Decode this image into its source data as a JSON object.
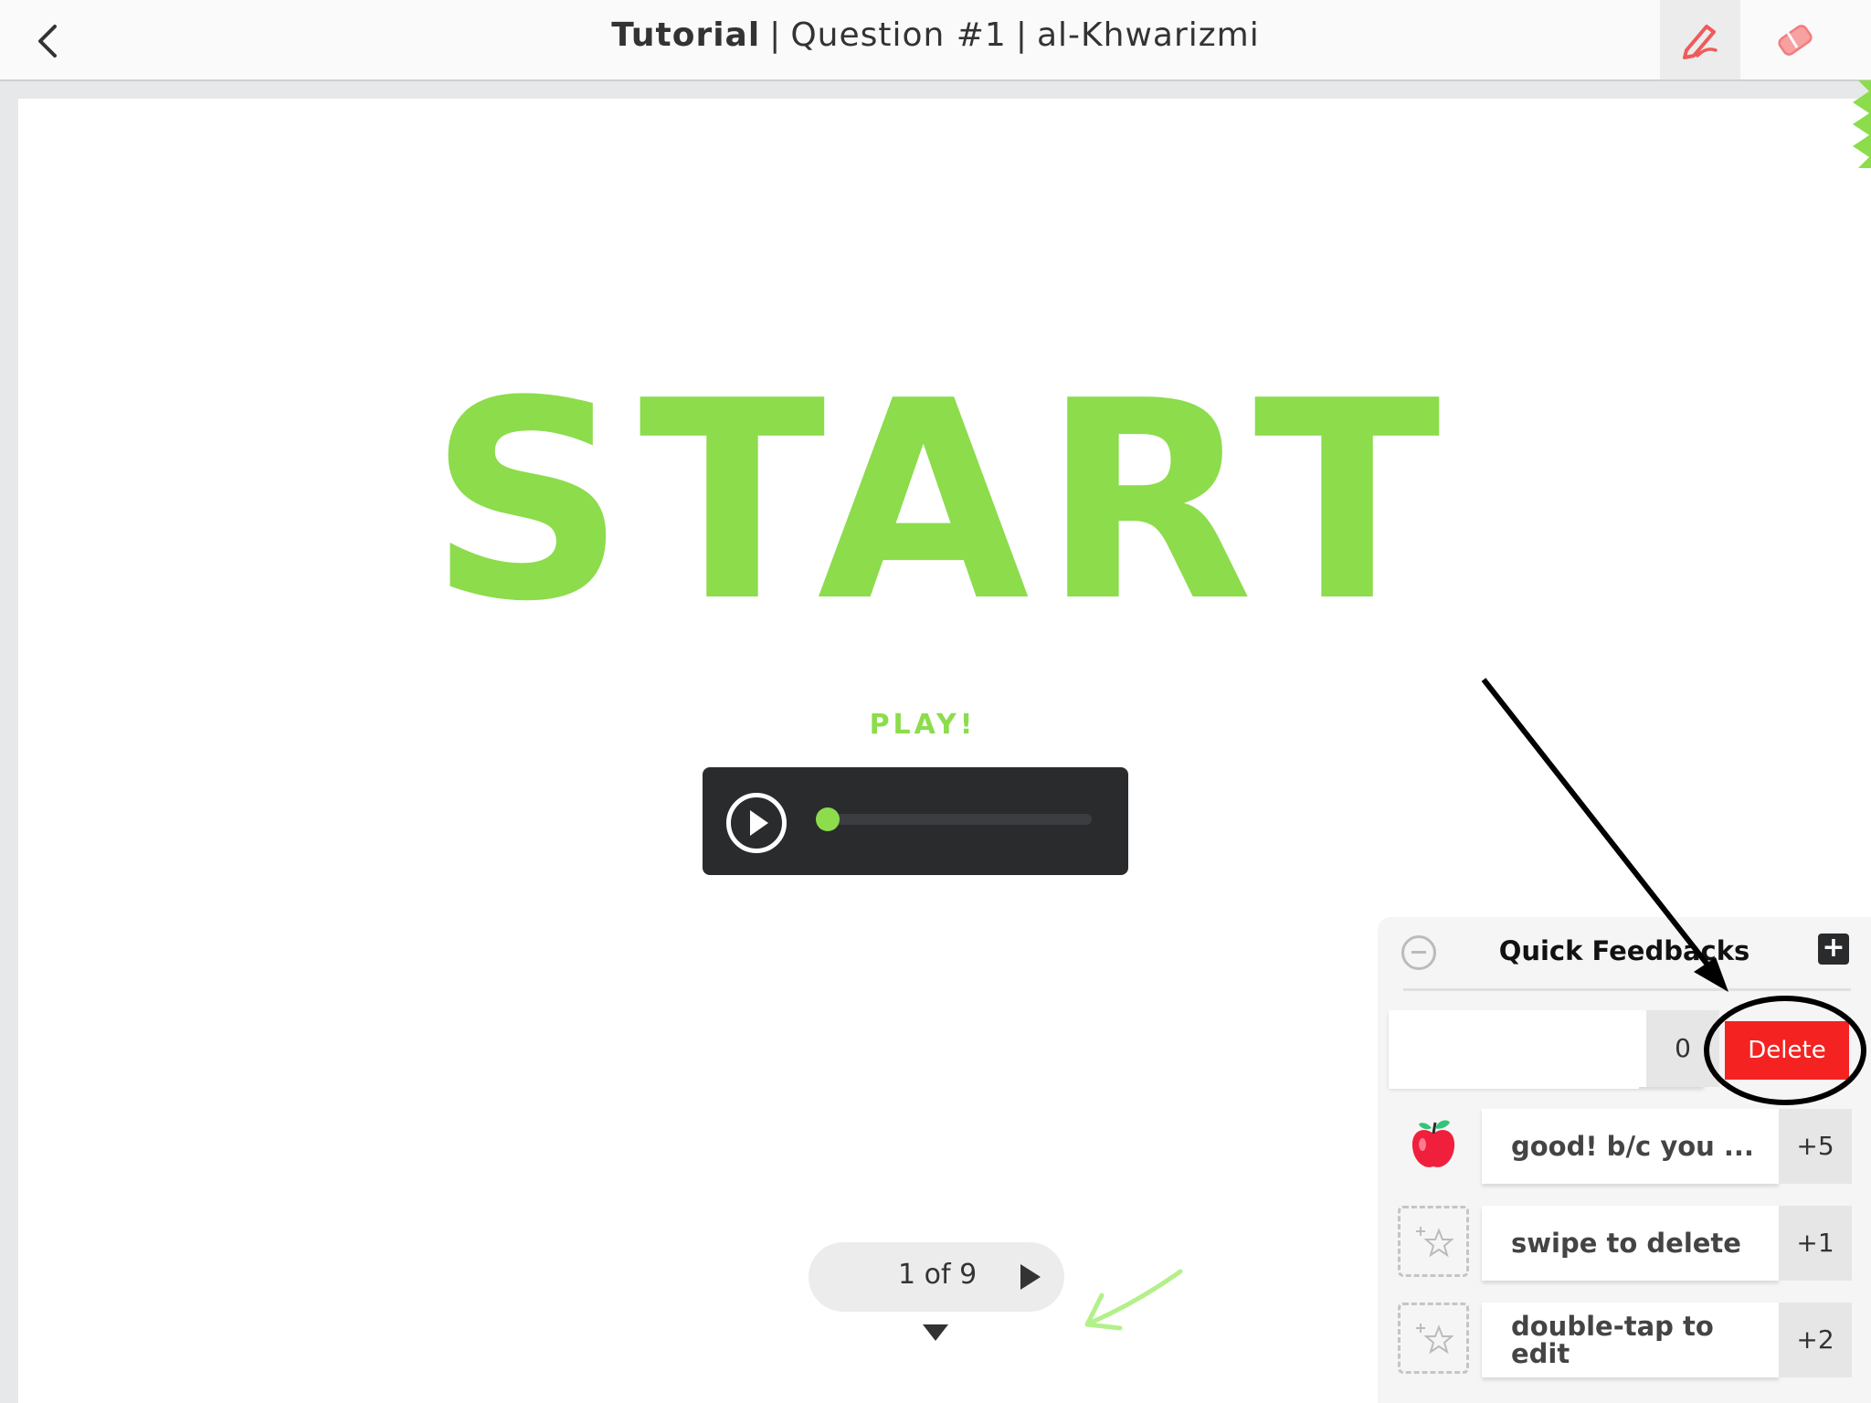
{
  "header": {
    "title_part1": "Tutorial",
    "title_part2": "Question #1",
    "title_part3": "al-Khwarizmi",
    "back_icon": "chevron-left-icon",
    "pen_icon": "pen-icon",
    "eraser_icon": "eraser-icon"
  },
  "content": {
    "heading": "START",
    "play_label": "PLAY!",
    "audio_progress_percent": 0
  },
  "pager": {
    "text": "1 of 9",
    "next_icon": "triangle-right-icon",
    "expand_icon": "triangle-down-icon"
  },
  "quick_feedbacks": {
    "title": "Quick Feedbacks",
    "new_item": {
      "value": "",
      "points": "0",
      "delete_label": "Delete"
    },
    "items": [
      {
        "label": "good! b/c you ...",
        "points": "+5",
        "icon": "apple-icon"
      },
      {
        "label": "swipe to delete",
        "points": "+1",
        "icon": "star-placeholder-icon"
      },
      {
        "label": "double-tap to edit",
        "points": "+2",
        "icon": "star-placeholder-icon"
      }
    ]
  },
  "colors": {
    "accent_green": "#8cdc4c",
    "delete_red": "#f52222",
    "dark": "#2a2b2d"
  }
}
